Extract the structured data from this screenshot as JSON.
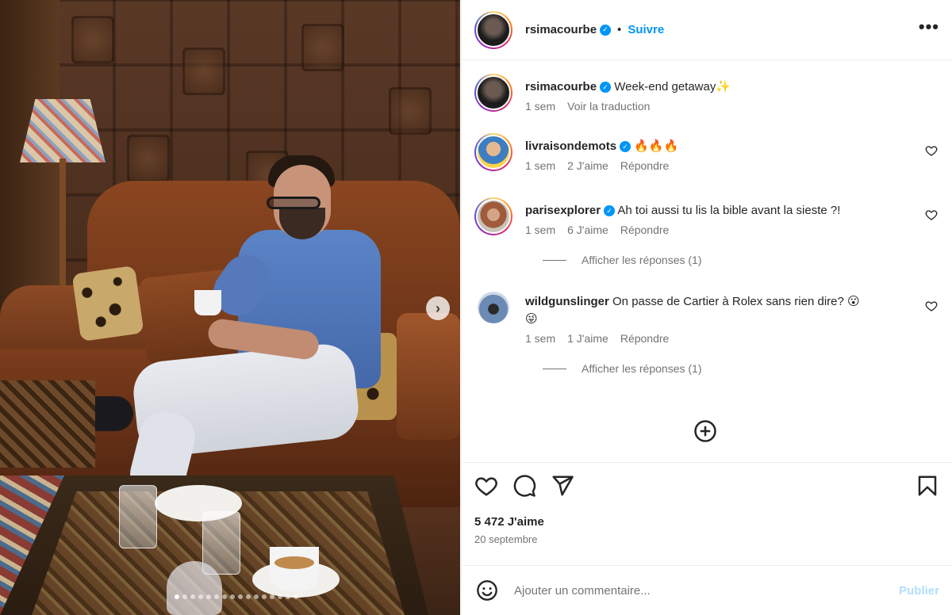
{
  "post": {
    "author": "rsimacourbe",
    "follow_label": "Suivre",
    "separator": "•",
    "more_label": "•••",
    "verified_mark": "✓",
    "caption": {
      "username": "rsimacourbe",
      "text": "Week-end getaway✨",
      "time": "1 sem",
      "translate": "Voir la traduction"
    },
    "comments": [
      {
        "username": "livraisondemots",
        "verified": true,
        "text": "🔥🔥🔥",
        "time": "1 sem",
        "likes": "2 J'aime",
        "reply": "Répondre"
      },
      {
        "username": "parisexplorer",
        "verified": true,
        "text": "Ah toi aussi tu lis la bible avant la sieste ?!",
        "time": "1 sem",
        "likes": "6 J'aime",
        "reply": "Répondre",
        "replies": "Afficher les réponses (1)"
      },
      {
        "username": "wildgunslinger",
        "verified": false,
        "text": "On passe de Cartier à Rolex sans rien dire? 😮",
        "text2": "😜",
        "time": "1 sem",
        "likes": "1 J'aime",
        "reply": "Répondre",
        "replies": "Afficher les réponses (1)"
      }
    ],
    "likes_count": "5 472 J'aime",
    "date": "20 septembre",
    "comment_placeholder": "Ajouter un commentaire...",
    "publish_label": "Publier",
    "carousel_next": "›"
  },
  "icons": {
    "like": "heart-icon",
    "comment": "comment-icon",
    "share": "share-icon",
    "save": "bookmark-icon",
    "emoji": "emoji-icon",
    "more": "more-icon",
    "load_more": "plus-circle-icon"
  },
  "colors": {
    "accent": "#0095f6",
    "publish_disabled": "#b2dffc",
    "muted_text": "#737373"
  }
}
